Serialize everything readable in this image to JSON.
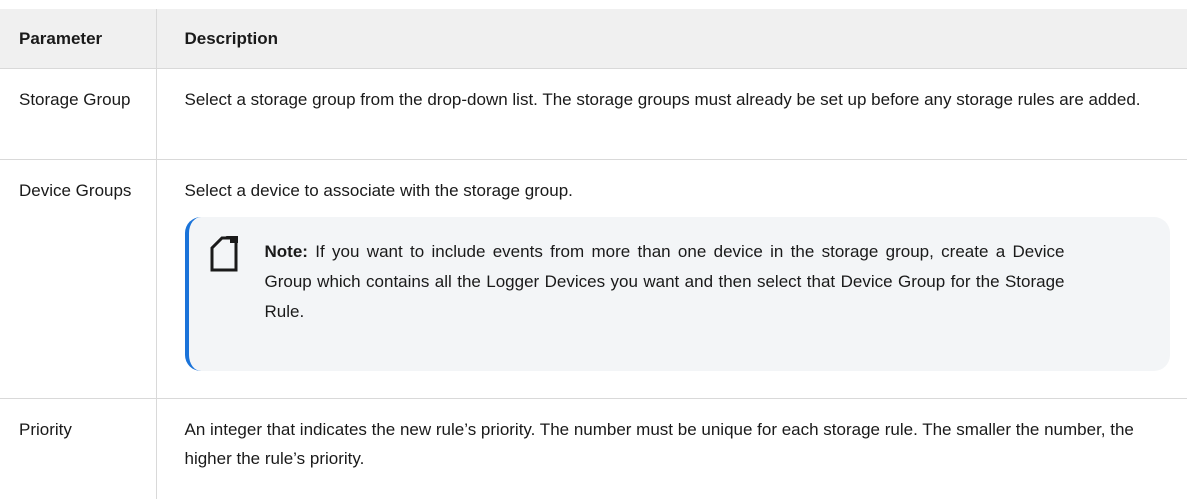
{
  "table": {
    "headers": {
      "parameter": "Parameter",
      "description": "Description"
    },
    "rows": [
      {
        "parameter": "Storage Group",
        "description": "Select a storage group from the drop-down list. The storage groups must already be set up before any storage rules are added."
      },
      {
        "parameter": "Device Groups",
        "description": "Select a device to associate with the storage group.",
        "note": {
          "label": "Note:",
          "text": " If you want to include events from more than one device in the storage group, create a Device Group which contains all the Logger Devices you want and then select that Device Group for the Storage Rule."
        }
      },
      {
        "parameter": "Priority",
        "description": "An integer that indicates the new rule’s priority. The number must be unique for each storage rule. The smaller the number, the higher the rule’s priority."
      }
    ]
  },
  "colors": {
    "header_bg": "#f0f0f0",
    "note_bg": "#f3f5f7",
    "note_accent": "#1a73d9",
    "border": "#d9d9d9"
  },
  "icons": {
    "note": "note-icon"
  }
}
